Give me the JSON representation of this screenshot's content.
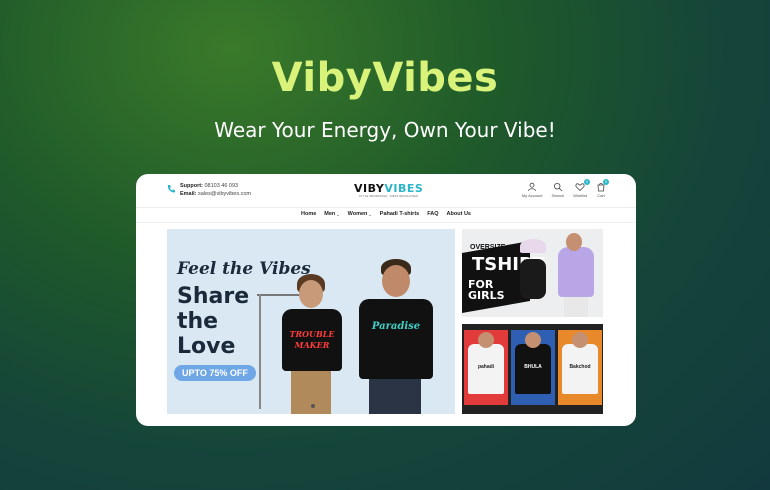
{
  "hero": {
    "title": "VibyVibes",
    "subtitle": "Wear Your Energy, Own Your Vibe!"
  },
  "topbar": {
    "support_label": "Support:",
    "support_value": "08103 46 093",
    "email_label": "Email:",
    "email_value": "sales@vibyvibes.com",
    "logo_part1": "VIBY",
    "logo_part2": "VIBES",
    "logo_tagline": "STYLE REFRESHED, VIBES REIMAGINED",
    "actions": [
      {
        "label": "My Account",
        "icon": "user-icon"
      },
      {
        "label": "Search",
        "icon": "search-icon"
      },
      {
        "label": "Wishlist",
        "icon": "heart-icon",
        "badge": "0"
      },
      {
        "label": "Cart",
        "icon": "cart-icon",
        "badge": "0"
      }
    ]
  },
  "nav": {
    "items": [
      "Home",
      "Men",
      "Women",
      "Pahadi T-shirts",
      "FAQ",
      "About Us"
    ]
  },
  "banner": {
    "line1": "Feel the Vibes",
    "line2": "Share",
    "line3": "the",
    "line4": "Love",
    "promo": "UPTO 75% OFF",
    "shirt1_print_a": "TROUBLE",
    "shirt1_print_b": "MAKER",
    "shirt2_print": "Paradise"
  },
  "side_banner_1": {
    "line1": "OVERSIZE",
    "line2": "TSHIRT",
    "line3a": "FOR",
    "line3b": "GIRLS"
  },
  "side_banner_2": {
    "tile1": "pahadi",
    "tile2": "BHULA",
    "tile3": "Bakchod"
  },
  "colors": {
    "accent": "#d9f27a",
    "brand_teal": "#2bb5c8",
    "promo_blue": "#6fa7e6"
  }
}
